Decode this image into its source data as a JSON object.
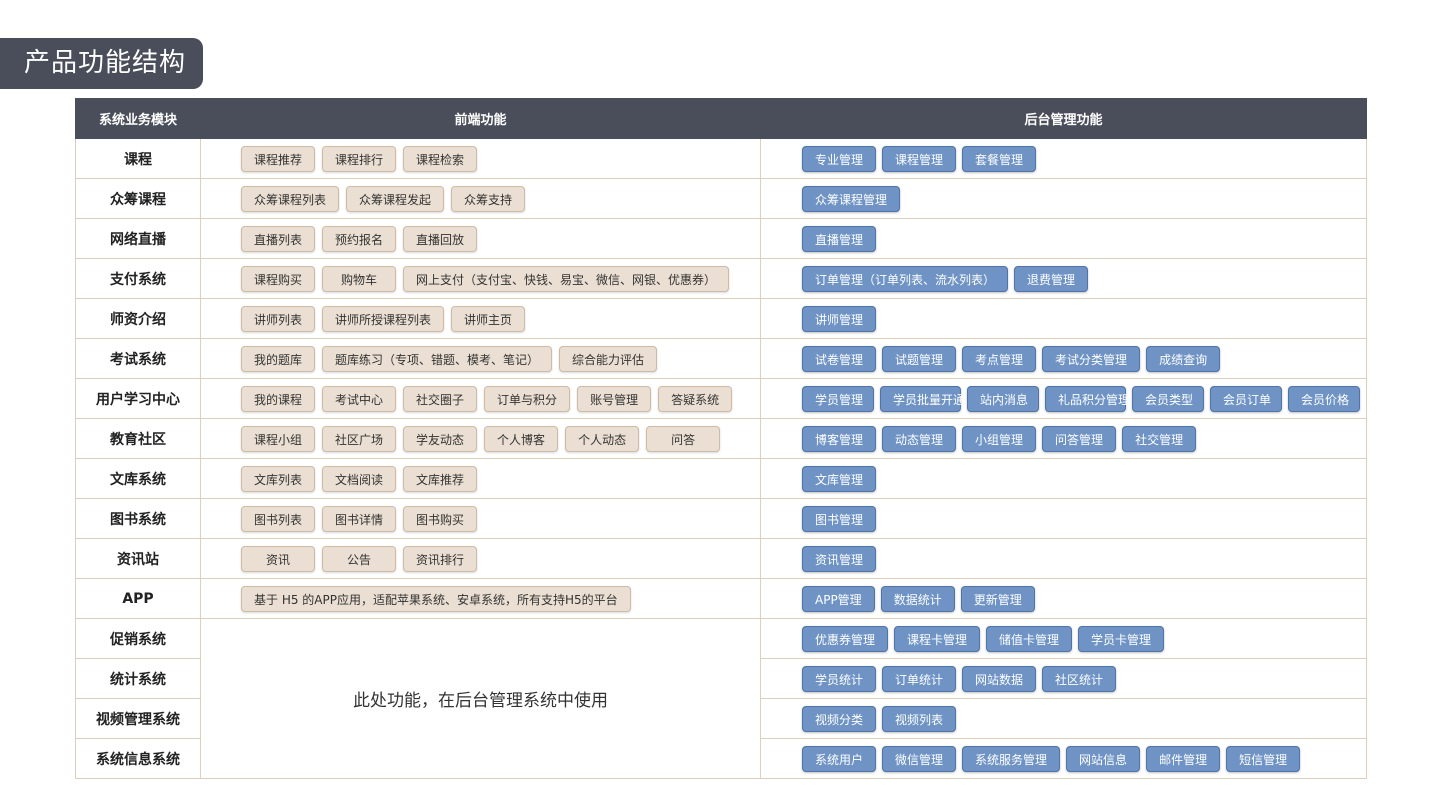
{
  "page_title": "产品功能结构",
  "headers": {
    "module": "系统业务模块",
    "front": "前端功能",
    "back": "后台管理功能"
  },
  "merged_note": "此处功能，在后台管理系统中使用",
  "colors": {
    "header_bg": "#4a4e5a",
    "front_chip": "#eadfd2",
    "back_chip": "#6e93c4",
    "border": "#dccfbe"
  },
  "rows": [
    {
      "module": "课程",
      "front": [
        "课程推荐",
        "课程排行",
        "课程检索"
      ],
      "back": [
        "专业管理",
        "课程管理",
        "套餐管理"
      ]
    },
    {
      "module": "众筹课程",
      "front": [
        "众筹课程列表",
        "众筹课程发起",
        "众筹支持"
      ],
      "back": [
        "众筹课程管理"
      ]
    },
    {
      "module": "网络直播",
      "front": [
        "直播列表",
        "预约报名",
        "直播回放"
      ],
      "back": [
        "直播管理"
      ]
    },
    {
      "module": "支付系统",
      "front": [
        "课程购买",
        "购物车",
        "网上支付（支付宝、快钱、易宝、微信、网银、优惠券）"
      ],
      "back": [
        "订单管理（订单列表、流水列表）",
        "退费管理"
      ]
    },
    {
      "module": "师资介绍",
      "front": [
        "讲师列表",
        "讲师所授课程列表",
        "讲师主页"
      ],
      "back": [
        "讲师管理"
      ]
    },
    {
      "module": "考试系统",
      "front": [
        "我的题库",
        "题库练习（专项、错题、模考、笔记）",
        "综合能力评估"
      ],
      "back": [
        "试卷管理",
        "试题管理",
        "考点管理",
        "考试分类管理",
        "成绩查询"
      ]
    },
    {
      "module": "用户学习中心",
      "front": [
        "我的课程",
        "考试中心",
        "社交圈子",
        "订单与积分",
        "账号管理",
        "答疑系统"
      ],
      "back": [
        "学员管理",
        "学员批量开通",
        "站内消息",
        "礼品积分管理",
        "会员类型",
        "会员订单",
        "会员价格"
      ]
    },
    {
      "module": "教育社区",
      "front": [
        "课程小组",
        "社区广场",
        "学友动态",
        "个人博客",
        "个人动态",
        "问答"
      ],
      "back": [
        "博客管理",
        "动态管理",
        "小组管理",
        "问答管理",
        "社交管理"
      ]
    },
    {
      "module": "文库系统",
      "front": [
        "文库列表",
        "文档阅读",
        "文库推荐"
      ],
      "back": [
        "文库管理"
      ]
    },
    {
      "module": "图书系统",
      "front": [
        "图书列表",
        "图书详情",
        "图书购买"
      ],
      "back": [
        "图书管理"
      ]
    },
    {
      "module": "资讯站",
      "front": [
        "资讯",
        "公告",
        "资讯排行"
      ],
      "back": [
        "资讯管理"
      ]
    },
    {
      "module": "APP",
      "front": [
        "基于 H5 的APP应用，适配苹果系统、安卓系统，所有支持H5的平台"
      ],
      "back": [
        "APP管理",
        "数据统计",
        "更新管理"
      ]
    },
    {
      "module": "促销系统",
      "front": [],
      "back": [
        "优惠券管理",
        "课程卡管理",
        "储值卡管理",
        "学员卡管理"
      ]
    },
    {
      "module": "统计系统",
      "front": [],
      "back": [
        "学员统计",
        "订单统计",
        "网站数据",
        "社区统计"
      ]
    },
    {
      "module": "视频管理系统",
      "front": [],
      "back": [
        "视频分类",
        "视频列表"
      ]
    },
    {
      "module": "系统信息系统",
      "front": [],
      "back": [
        "系统用户",
        "微信管理",
        "系统服务管理",
        "网站信息",
        "邮件管理",
        "短信管理"
      ]
    }
  ]
}
